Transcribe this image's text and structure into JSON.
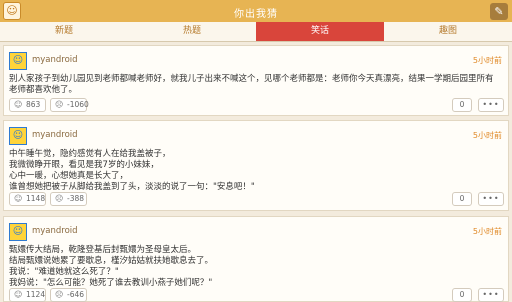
{
  "header": {
    "title": "你出我猜",
    "app_icon": "smiley-icon",
    "edit_icon": "pen-icon"
  },
  "tabs": [
    {
      "label": "新题"
    },
    {
      "label": "热题"
    },
    {
      "label": "笑话",
      "active": true
    },
    {
      "label": "趣图"
    }
  ],
  "posts": [
    {
      "user": "myandroid",
      "time": "5小时前",
      "text": "别人家孩子到幼儿园见到老师都喊老师好，就我儿子出来不喊这个，见哪个老师都是：老师你今天真漂亮，结果一学期后园里所有老师都喜欢他了。",
      "likes": "863",
      "dislikes": "-1060",
      "comments": "0",
      "more": "•••"
    },
    {
      "user": "myandroid",
      "time": "5小时前",
      "text": "中午睡午觉，隐约感觉有人在给我盖被子，\n我微微睁开眼，看见是我7岁的小妹妹，\n心中一暖，心想她真是长大了，\n谁曾想她把被子从脚给我盖到了头，淡淡的说了一句：\"安息吧！\"",
      "likes": "1148",
      "dislikes": "-388",
      "comments": "0",
      "more": "•••"
    },
    {
      "user": "myandroid",
      "time": "5小时前",
      "text": "甄嬛传大结局，乾隆登基后封甄嬛为圣母皇太后。\n结局甄嬛说她累了要歇息，槿汐姑姑就扶她歇息去了。\n我说：\"难道她就这么死了？\"\n我妈说：\"怎么可能？她死了谁去教训小燕子她们呢？\"",
      "likes": "1124",
      "dislikes": "-646",
      "comments": "0",
      "more": "•••"
    }
  ]
}
